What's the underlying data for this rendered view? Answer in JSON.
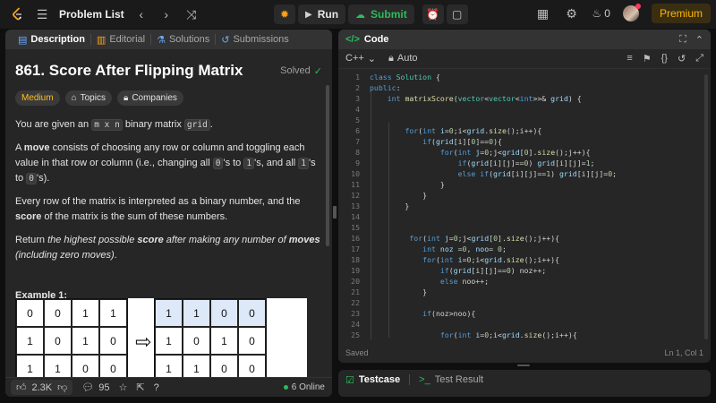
{
  "topbar": {
    "problem_list": "Problem List",
    "run_label": "Run",
    "submit_label": "Submit",
    "streak_count": "0",
    "premium_label": "Premium"
  },
  "left_tabs": [
    {
      "label": "Description"
    },
    {
      "label": "Editorial"
    },
    {
      "label": "Solutions"
    },
    {
      "label": "Submissions"
    }
  ],
  "problem": {
    "title": "861. Score After Flipping Matrix",
    "status": "Solved",
    "difficulty": "Medium",
    "topics": "Topics",
    "companies": "Companies",
    "p1_pre": "You are given an ",
    "p1_code1": "m x n",
    "p1_mid": " binary matrix ",
    "p1_code2": "grid",
    "p1_post": ".",
    "p2_pre": "A ",
    "p2_bold": "move",
    "p2_mid": " consists of choosing any row or column and toggling each value in that row or column (i.e., changing all ",
    "p2_code1": "0",
    "p2_mid2": "'s to ",
    "p2_code2": "1",
    "p2_mid3": "'s, and all ",
    "p2_code3": "1",
    "p2_mid4": "'s to ",
    "p2_code4": "0",
    "p2_post": "'s).",
    "p3_pre": "Every row of the matrix is interpreted as a binary number, and the ",
    "p3_bold": "score",
    "p3_post": " of the matrix is the sum of these numbers.",
    "p4_pre": "Return ",
    "p4_it1": "the highest possible ",
    "p4_bold1": "score",
    "p4_it2": " after making any number of ",
    "p4_bold2": "moves",
    "p4_it3": " (including zero moves)",
    "p4_post": ".",
    "example_title": "Example 1:",
    "grid_before": [
      [
        "0",
        "0",
        "1",
        "1"
      ],
      [
        "1",
        "0",
        "1",
        "0"
      ],
      [
        "1",
        "1",
        "0",
        "0"
      ]
    ],
    "grid_after": [
      [
        "1",
        "1",
        "0",
        "0"
      ],
      [
        "1",
        "0",
        "1",
        "0"
      ],
      [
        "1",
        "1",
        "0",
        "0"
      ]
    ]
  },
  "footer": {
    "likes": "2.3K",
    "comments": "95",
    "online": "6 Online"
  },
  "code_panel": {
    "title": "Code",
    "language": "C++",
    "auto_label": "Auto",
    "saved": "Saved",
    "cursor": "Ln 1, Col 1"
  },
  "code_lines": [
    "1",
    "2",
    "3",
    "4",
    "5",
    "6",
    "7",
    "8",
    "9",
    "10",
    "11",
    "12",
    "13",
    "14",
    "15",
    "16",
    "17",
    "18",
    "19",
    "20",
    "21",
    "22",
    "23",
    "24",
    "25"
  ],
  "bottom_tabs": {
    "testcase": "Testcase",
    "test_result": "Test Result"
  }
}
